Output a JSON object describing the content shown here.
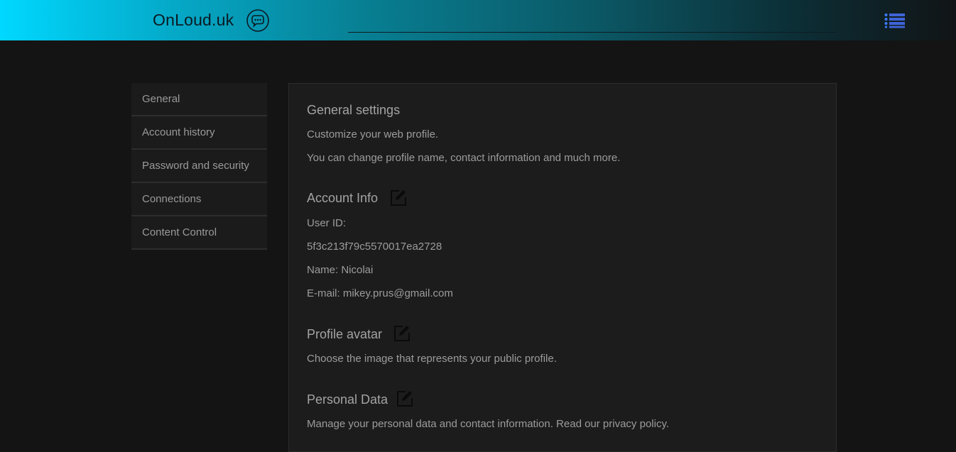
{
  "header": {
    "logo": "OnLoud.uk",
    "chat_icon": "chat-bubble-icon",
    "menu_icon": "list-menu-icon"
  },
  "sidebar": {
    "items": [
      {
        "label": "General"
      },
      {
        "label": "Account history"
      },
      {
        "label": "Password and security"
      },
      {
        "label": "Connections"
      },
      {
        "label": "Content Control"
      }
    ]
  },
  "main": {
    "general": {
      "title": "General settings",
      "line1": "Customize your web profile.",
      "line2": "You can change profile name, contact information and much more."
    },
    "account": {
      "title": "Account Info",
      "user_id_label": "User ID:",
      "user_id": "5f3c213f79c5570017ea2728",
      "name": "Name: Nicolai",
      "email": "E-mail: mikey.prus@gmail.com"
    },
    "avatar": {
      "title": "Profile avatar",
      "desc": "Choose the image that represents your public profile."
    },
    "personal": {
      "title": "Personal Data",
      "desc": "Manage your personal data and contact information. Read our privacy policy."
    }
  },
  "colors": {
    "header_gradient_start": "#00d8ff",
    "header_gradient_end": "#111416",
    "background": "#141414",
    "panel": "#1c1c1c",
    "text": "#9c9c9c"
  }
}
